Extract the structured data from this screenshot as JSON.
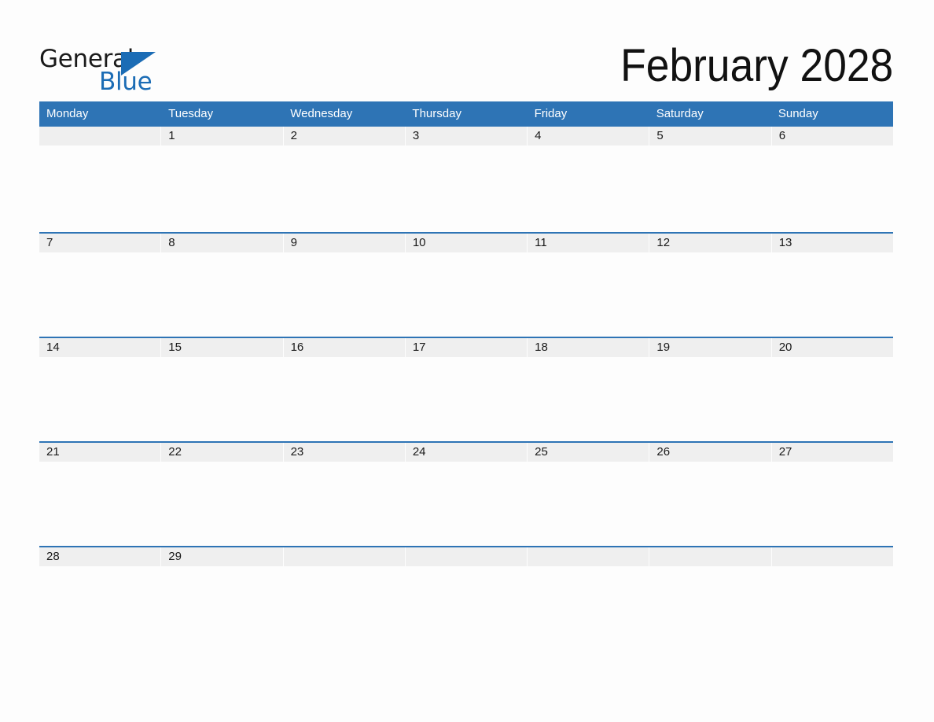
{
  "brand": {
    "name_part1": "General",
    "name_part2": "Blue",
    "triangle_color": "#1b6cb5",
    "text_color": "#1a1a1a"
  },
  "header": {
    "title": "February 2028",
    "month": "February",
    "year": "2028"
  },
  "theme": {
    "header_blue": "#2e74b5",
    "day_band_gray": "#efefef",
    "page_background": "#fdfdfd",
    "separator_blue": "#2e74b5",
    "text_dark": "#1a1a1a",
    "header_text": "#ffffff"
  },
  "calendar": {
    "week_start": "Monday",
    "day_headers": [
      "Monday",
      "Tuesday",
      "Wednesday",
      "Thursday",
      "Friday",
      "Saturday",
      "Sunday"
    ],
    "weeks": [
      {
        "index": 0,
        "days": [
          {
            "label": "",
            "empty": true
          },
          {
            "label": "1",
            "empty": false
          },
          {
            "label": "2",
            "empty": false
          },
          {
            "label": "3",
            "empty": false
          },
          {
            "label": "4",
            "empty": false
          },
          {
            "label": "5",
            "empty": false
          },
          {
            "label": "6",
            "empty": false
          }
        ]
      },
      {
        "index": 1,
        "days": [
          {
            "label": "7",
            "empty": false
          },
          {
            "label": "8",
            "empty": false
          },
          {
            "label": "9",
            "empty": false
          },
          {
            "label": "10",
            "empty": false
          },
          {
            "label": "11",
            "empty": false
          },
          {
            "label": "12",
            "empty": false
          },
          {
            "label": "13",
            "empty": false
          }
        ]
      },
      {
        "index": 2,
        "days": [
          {
            "label": "14",
            "empty": false
          },
          {
            "label": "15",
            "empty": false
          },
          {
            "label": "16",
            "empty": false
          },
          {
            "label": "17",
            "empty": false
          },
          {
            "label": "18",
            "empty": false
          },
          {
            "label": "19",
            "empty": false
          },
          {
            "label": "20",
            "empty": false
          }
        ]
      },
      {
        "index": 3,
        "days": [
          {
            "label": "21",
            "empty": false
          },
          {
            "label": "22",
            "empty": false
          },
          {
            "label": "23",
            "empty": false
          },
          {
            "label": "24",
            "empty": false
          },
          {
            "label": "25",
            "empty": false
          },
          {
            "label": "26",
            "empty": false
          },
          {
            "label": "27",
            "empty": false
          }
        ]
      },
      {
        "index": 4,
        "days": [
          {
            "label": "28",
            "empty": false
          },
          {
            "label": "29",
            "empty": false
          },
          {
            "label": "",
            "empty": true
          },
          {
            "label": "",
            "empty": true
          },
          {
            "label": "",
            "empty": true
          },
          {
            "label": "",
            "empty": true
          },
          {
            "label": "",
            "empty": true
          }
        ]
      }
    ]
  }
}
